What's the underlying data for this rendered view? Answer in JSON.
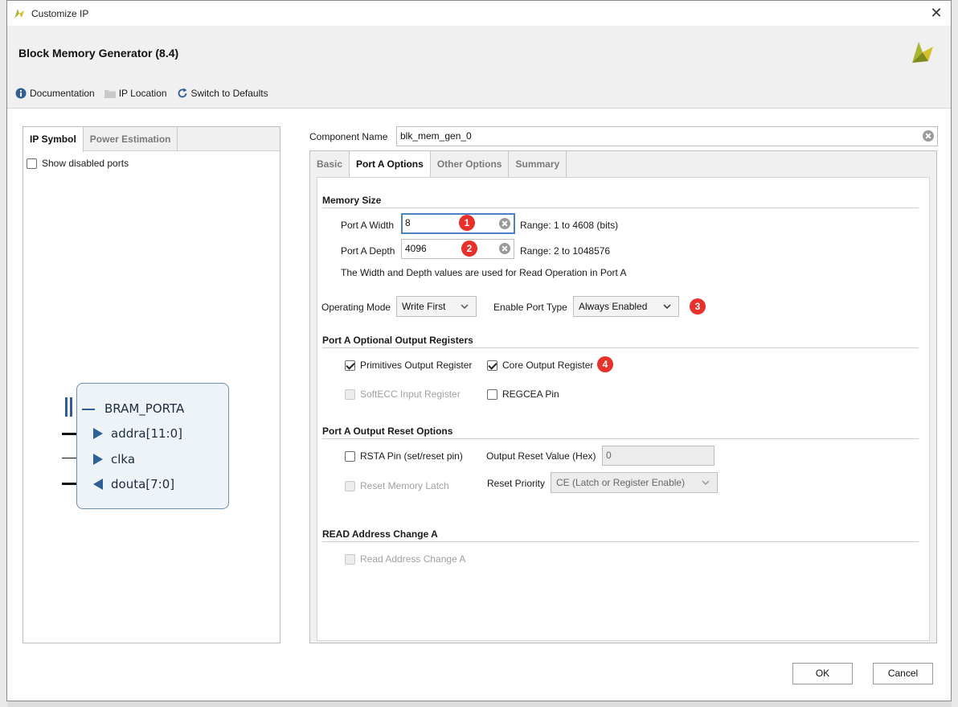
{
  "window": {
    "title": "Customize IP"
  },
  "header": {
    "ip_title": "Block Memory Generator (8.4)",
    "toolbar": {
      "documentation": "Documentation",
      "ip_location": "IP Location",
      "switch_defaults": "Switch to Defaults"
    }
  },
  "left_panel": {
    "tabs": [
      "IP Symbol",
      "Power Estimation"
    ],
    "show_disabled_ports": "Show disabled ports",
    "symbol": {
      "bus_name": "BRAM_PORTA",
      "ports": [
        "addra[11:0]",
        "clka",
        "douta[7:0]"
      ]
    }
  },
  "component": {
    "label": "Component Name",
    "value": "blk_mem_gen_0"
  },
  "tabs": [
    "Basic",
    "Port A Options",
    "Other Options",
    "Summary"
  ],
  "memory_size": {
    "title": "Memory Size",
    "width_label": "Port A Width",
    "width_value": "8",
    "width_range": "Range: 1 to 4608 (bits)",
    "depth_label": "Port A Depth",
    "depth_value": "4096",
    "depth_range": "Range: 2 to 1048576",
    "note": "The Width and Depth values are used for Read Operation in Port A"
  },
  "operating": {
    "mode_label": "Operating Mode",
    "mode_value": "Write First",
    "port_type_label": "Enable Port Type",
    "port_type_value": "Always Enabled"
  },
  "optional_regs": {
    "title": "Port A Optional Output Registers",
    "primitives": "Primitives Output Register",
    "core": "Core Output Register",
    "softecc": "SoftECC Input Register",
    "regcea": "REGCEA Pin"
  },
  "reset_opts": {
    "title": "Port A Output Reset Options",
    "rsta": "RSTA Pin (set/reset pin)",
    "reset_value_label": "Output Reset Value (Hex)",
    "reset_value": "0",
    "reset_latch": "Reset Memory Latch",
    "priority_label": "Reset Priority",
    "priority_value": "CE (Latch or Register Enable)"
  },
  "read_addr": {
    "title": "READ Address Change A",
    "option": "Read Address Change A"
  },
  "badges": [
    "1",
    "2",
    "3",
    "4"
  ],
  "buttons": {
    "ok": "OK",
    "cancel": "Cancel"
  },
  "colors": {
    "badge": "#e8312a",
    "focus": "#4a82c4",
    "brand": "#a8b530"
  }
}
